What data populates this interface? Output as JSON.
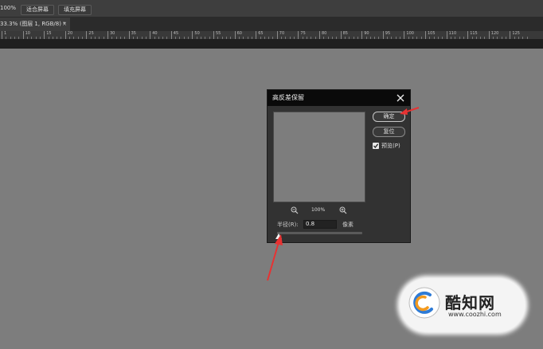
{
  "options_bar": {
    "zoom_value": "100%",
    "fit_screen_label": "适合屏幕",
    "fill_screen_label": "填充屏幕"
  },
  "document_tab": {
    "title": "33.3% (图层 1, RGB/8) *",
    "close_glyph": "×"
  },
  "ruler": {
    "ticks": [
      "1",
      "10",
      "15",
      "20",
      "25",
      "30",
      "35",
      "40",
      "45",
      "50",
      "55",
      "60",
      "65",
      "70",
      "75",
      "80",
      "85",
      "90",
      "95",
      "100",
      "105",
      "110",
      "115",
      "120",
      "125"
    ]
  },
  "dialog": {
    "title": "高反差保留",
    "close_icon": "close-icon",
    "ok_label": "确定",
    "reset_label": "复位",
    "preview_checkbox": {
      "label": "预览(P)",
      "checked": true
    },
    "zoom_percent": "100%",
    "zoom_out_icon": "zoom-out-icon",
    "zoom_in_icon": "zoom-in-icon",
    "radius": {
      "label": "半径(R):",
      "value": "0.8",
      "unit": "像素"
    },
    "slider": {
      "value_fraction": 0.02
    }
  },
  "annotations": {
    "arrow_color": "#e83232"
  },
  "watermark": {
    "brand": "酷知网",
    "url": "www.coozhi.com"
  }
}
